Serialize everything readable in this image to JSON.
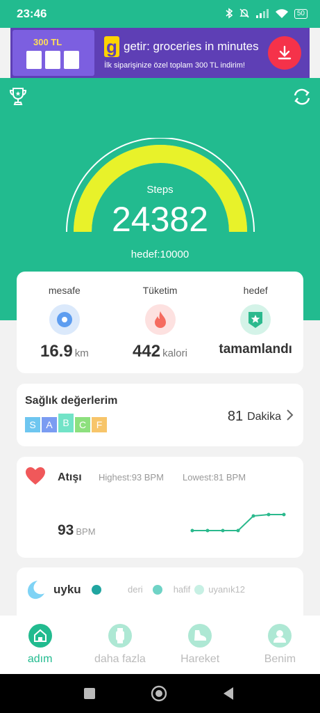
{
  "status_bar": {
    "time": "23:46",
    "battery": "50"
  },
  "ad": {
    "thumb_amount": "300 TL",
    "title": "getir: groceries in minutes",
    "subtitle": "İlk siparişinize özel toplam 300 TL indirim!",
    "logo_letter": "g",
    "colors": {
      "background": "#5e3fb5",
      "download": "#f5324a",
      "logo": "#ffd300"
    }
  },
  "hero": {
    "steps_label": "Steps",
    "steps_value": "24382",
    "goal_text": "hedef:10000",
    "progress_fraction": 1.0
  },
  "stats": {
    "distance": {
      "label": "mesafe",
      "value": "16.9",
      "unit": "km"
    },
    "consumption": {
      "label": "Tüketim",
      "value": "442",
      "unit": "kalori"
    },
    "goal": {
      "label": "hedef",
      "value": "tamamlandı"
    }
  },
  "health": {
    "title": "Sağlık değerlerim",
    "grades": [
      {
        "letter": "S",
        "color": "#6ec6f0"
      },
      {
        "letter": "A",
        "color": "#7a9cf2"
      },
      {
        "letter": "B",
        "color": "#72e3c7"
      },
      {
        "letter": "C",
        "color": "#8de07e"
      },
      {
        "letter": "F",
        "color": "#f7c56a"
      }
    ],
    "active_grade": "B",
    "value": "81",
    "unit": "Dakika"
  },
  "heart": {
    "title": "Atışı",
    "highest": "Highest:93  BPM",
    "lowest": "Lowest:81  BPM",
    "current_value": "93",
    "current_unit": "BPM"
  },
  "sleep": {
    "title": "uyku",
    "legend": [
      {
        "label": "",
        "color": "#20a5a0"
      },
      {
        "label": "deri",
        "color": "#6fd3c6"
      },
      {
        "label": "hafif",
        "color": "#c7f0e4"
      },
      {
        "label": "uyanık12",
        "color": ""
      }
    ]
  },
  "nav": {
    "items": [
      {
        "label": "adım"
      },
      {
        "label": "daha fazla"
      },
      {
        "label": "Hareket"
      },
      {
        "label": "Benim"
      }
    ]
  },
  "colors": {
    "primary": "#22bb8f",
    "gauge": "#e8f22a",
    "heart": "#f0585a"
  }
}
